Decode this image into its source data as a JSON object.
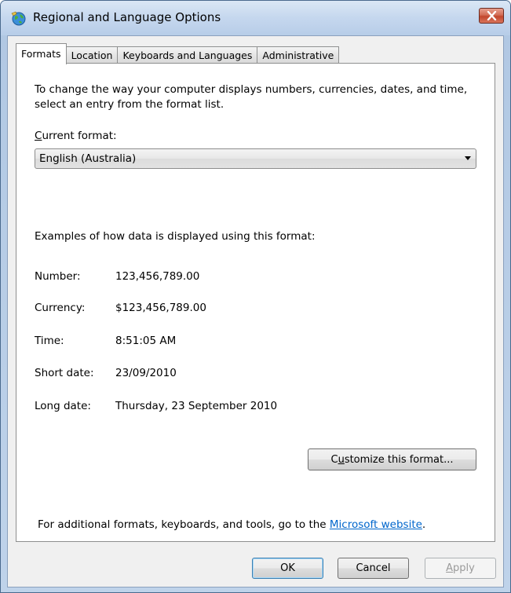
{
  "window": {
    "title": "Regional and Language Options"
  },
  "tabs": [
    {
      "label": "Formats",
      "active": true
    },
    {
      "label": "Location",
      "active": false
    },
    {
      "label": "Keyboards and Languages",
      "active": false
    },
    {
      "label": "Administrative",
      "active": false
    }
  ],
  "formats": {
    "intro": "To change the way your computer displays numbers, currencies, dates, and time, select an entry from the format list.",
    "current_format_label_accel": "C",
    "current_format_label_rest": "urrent format:",
    "current_format_value": "English (Australia)",
    "examples_heading": "Examples of how data is displayed using this format:",
    "examples": [
      {
        "label": "Number:",
        "value": "123,456,789.00"
      },
      {
        "label": "Currency:",
        "value": "$123,456,789.00"
      },
      {
        "label": "Time:",
        "value": "8:51:05 AM"
      },
      {
        "label": "Short date:",
        "value": "23/09/2010"
      },
      {
        "label": "Long date:",
        "value": "Thursday, 23 September 2010"
      }
    ],
    "customize_button_pre": "C",
    "customize_button_accel": "u",
    "customize_button_post": "stomize this format...",
    "footer_text": "For additional formats, keyboards, and tools, go to the ",
    "footer_link": "Microsoft website",
    "footer_period": "."
  },
  "buttons": {
    "ok": "OK",
    "cancel": "Cancel",
    "apply_accel": "A",
    "apply_rest": "pply"
  },
  "colors": {
    "link": "#0066cc",
    "close_button": "#c2462c"
  },
  "icons": {
    "title": "globe-icon",
    "close": "close-icon",
    "combo": "chevron-down-icon"
  }
}
